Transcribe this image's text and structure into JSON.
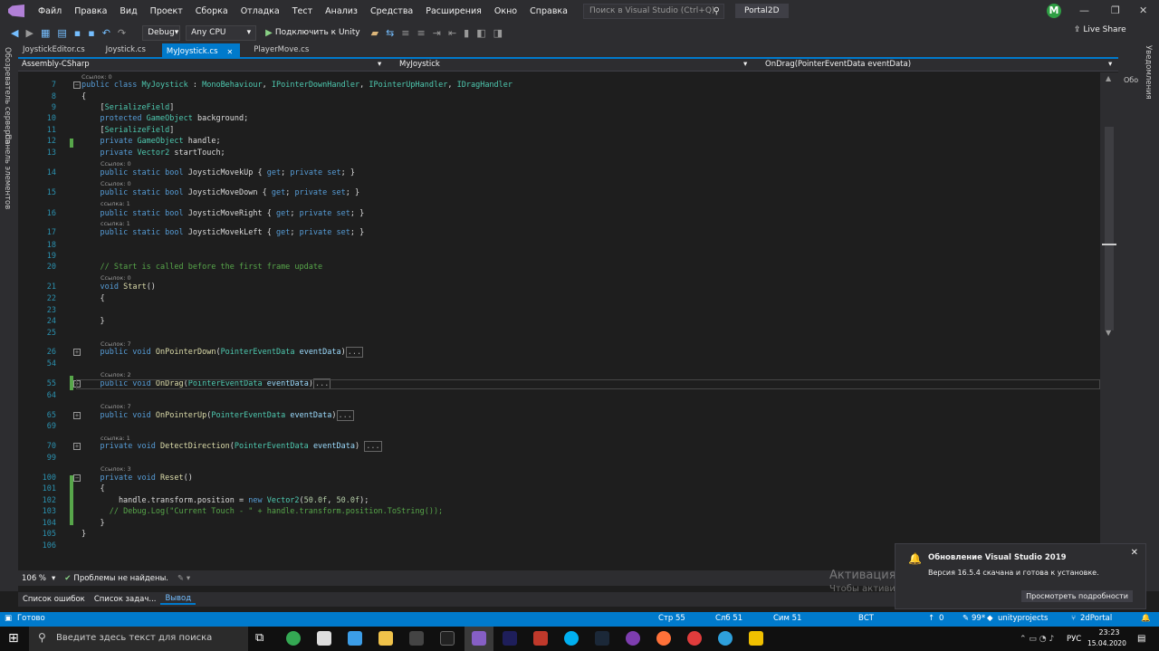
{
  "menu": {
    "items": [
      "Файл",
      "Правка",
      "Вид",
      "Проект",
      "Сборка",
      "Отладка",
      "Тест",
      "Анализ",
      "Средства",
      "Расширения",
      "Окно",
      "Справка"
    ],
    "search_placeholder": "Поиск в Visual Studio (Ctrl+Q)",
    "solution": "Portal2D",
    "avatar": "M"
  },
  "toolbar": {
    "config": "Debug",
    "platform": "Any CPU",
    "attach": "Подключить к Unity",
    "liveshare": "Live Share"
  },
  "left_panels": [
    "Обозреватель серверов",
    "Панель элементов"
  ],
  "right_panel": [
    "Уведомления",
    "Обо"
  ],
  "tabs": [
    {
      "label": "JoystickEditor.cs"
    },
    {
      "label": "Joystick.cs"
    },
    {
      "label": "MyJoystick.cs",
      "active": true
    },
    {
      "label": "PlayerMove.cs"
    }
  ],
  "nav": {
    "project": "Assembly-CSharp",
    "class": "MyJoystick",
    "member": "OnDrag(PointerEventData eventData)"
  },
  "lens": {
    "l7": "Ссылок: 0",
    "l14": "Ссылок: 0",
    "l15": "Ссылок: 0",
    "l16": "ссылка: 1",
    "l17": "ссылка: 1",
    "l21": "Ссылок: 0",
    "l26": "Ссылок: 7",
    "l55": "Ссылок: 2",
    "l65": "Ссылок: 7",
    "l70": "ссылка: 1",
    "l100": "Ссылок: 3"
  },
  "lines": [
    "7",
    "8",
    "9",
    "10",
    "11",
    "12",
    "13",
    "14",
    "15",
    "16",
    "17",
    "18",
    "19",
    "20",
    "21",
    "22",
    "23",
    "24",
    "25",
    "26",
    "54",
    "55",
    "64",
    "65",
    "69",
    "70",
    "99",
    "100",
    "101",
    "102",
    "103",
    "104",
    "105",
    "106"
  ],
  "status_row": {
    "zoom": "106 %",
    "issues": "Проблемы не найдены."
  },
  "bottom_tabs": [
    "Список ошибок",
    "Список задач...",
    "Вывод"
  ],
  "statusbar": {
    "ready": "Готово",
    "line": "Стр 55",
    "col": "Слб 51",
    "ch": "Сим 51",
    "mode": "ВСТ",
    "up": "0",
    "pencil": "99*",
    "repo": "unityprojects",
    "branch": "2dPortal"
  },
  "taskbar": {
    "search": "Введите здесь текст для поиска",
    "time": "23:23",
    "date": "15.04.2020",
    "lang": "РУС"
  },
  "notification": {
    "title": "Обновление Visual Studio 2019",
    "body": "Версия 16.5.4 скачана и готова к установке.",
    "button": "Просмотреть подробности"
  },
  "activation": {
    "title": "Активация Windows",
    "body": "Чтобы активировать Windows, перейдите в раздел \"Параметры\"."
  }
}
